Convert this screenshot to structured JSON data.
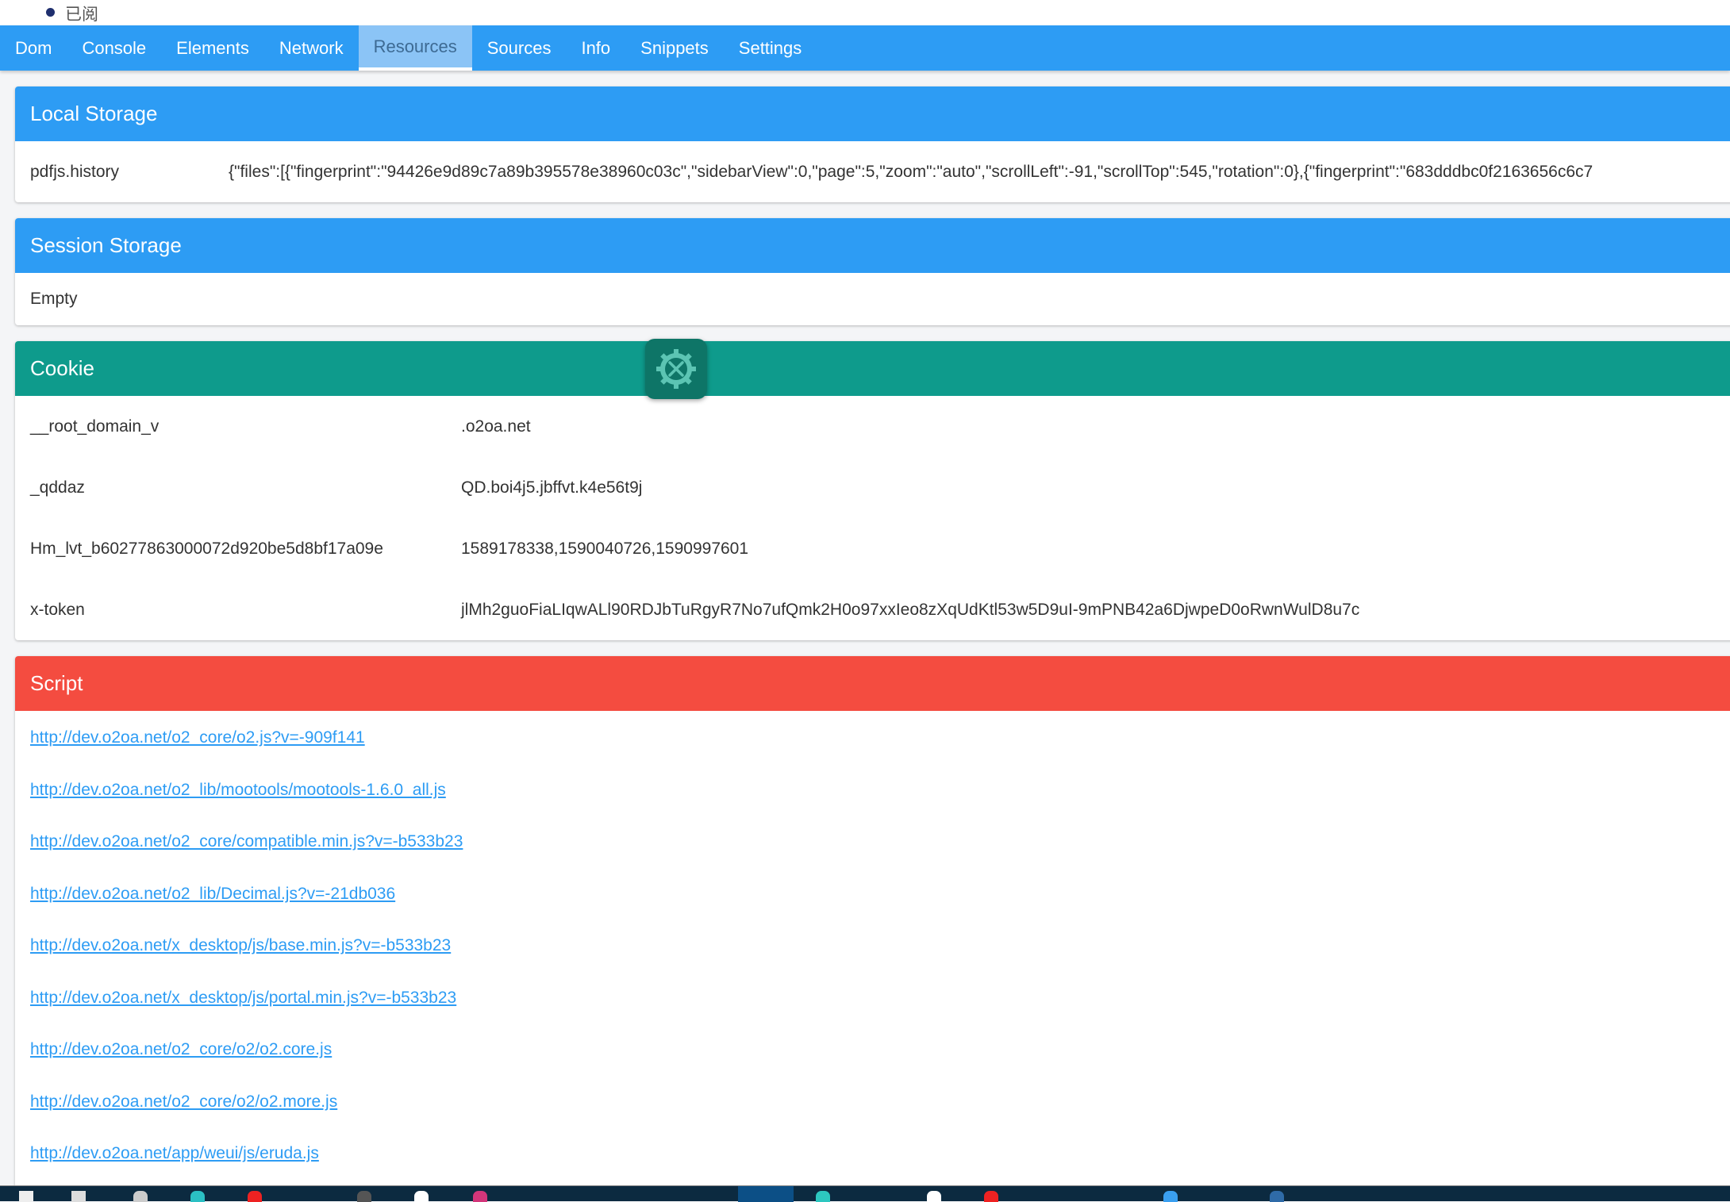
{
  "top_item": {
    "text": "已阅"
  },
  "tabs": [
    {
      "label": "Dom"
    },
    {
      "label": "Console"
    },
    {
      "label": "Elements"
    },
    {
      "label": "Network"
    },
    {
      "label": "Resources",
      "active": true
    },
    {
      "label": "Sources"
    },
    {
      "label": "Info"
    },
    {
      "label": "Snippets"
    },
    {
      "label": "Settings"
    }
  ],
  "local_storage": {
    "title": "Local Storage",
    "color": "#2d9cf4",
    "items": [
      {
        "key": "pdfjs.history",
        "value": "{\"files\":[{\"fingerprint\":\"94426e9d89c7a89b395578e38960c03c\",\"sidebarView\":0,\"page\":5,\"zoom\":\"auto\",\"scrollLeft\":-91,\"scrollTop\":545,\"rotation\":0},{\"fingerprint\":\"683dddbc0f2163656c6c7"
      }
    ]
  },
  "session_storage": {
    "title": "Session Storage",
    "color": "#2d9cf4",
    "empty_text": "Empty"
  },
  "cookie": {
    "title": "Cookie",
    "color": "#0e9b8c",
    "items": [
      {
        "key": "__root_domain_v",
        "value": ".o2oa.net"
      },
      {
        "key": "_qddaz",
        "value": "QD.boi4j5.jbffvt.k4e56t9j"
      },
      {
        "key": "Hm_lvt_b60277863000072d920be5d8bf17a09e",
        "value": "1589178338,1590040726,1590997601"
      },
      {
        "key": "x-token",
        "value": "jlMh2guoFiaLIqwALl90RDJbTuRgyR7No7ufQmk2H0o97xxIeo8zXqUdKtl53w5D9uI-9mPNB42a6DjwpeD0oRwnWulD8u7c"
      }
    ]
  },
  "script": {
    "title": "Script",
    "color": "#f44c40",
    "links": [
      "http://dev.o2oa.net/o2_core/o2.js?v=-909f141",
      "http://dev.o2oa.net/o2_lib/mootools/mootools-1.6.0_all.js",
      "http://dev.o2oa.net/o2_core/compatible.min.js?v=-b533b23",
      "http://dev.o2oa.net/o2_lib/Decimal.js?v=-21db036",
      "http://dev.o2oa.net/x_desktop/js/base.min.js?v=-b533b23",
      "http://dev.o2oa.net/x_desktop/js/portal.min.js?v=-b533b23",
      "http://dev.o2oa.net/o2_core/o2/o2.core.js",
      "http://dev.o2oa.net/o2_core/o2/o2.more.js",
      "http://dev.o2oa.net/app/weui/js/eruda.js"
    ]
  },
  "floating_button": {
    "icon": "tools-gear-icon"
  }
}
